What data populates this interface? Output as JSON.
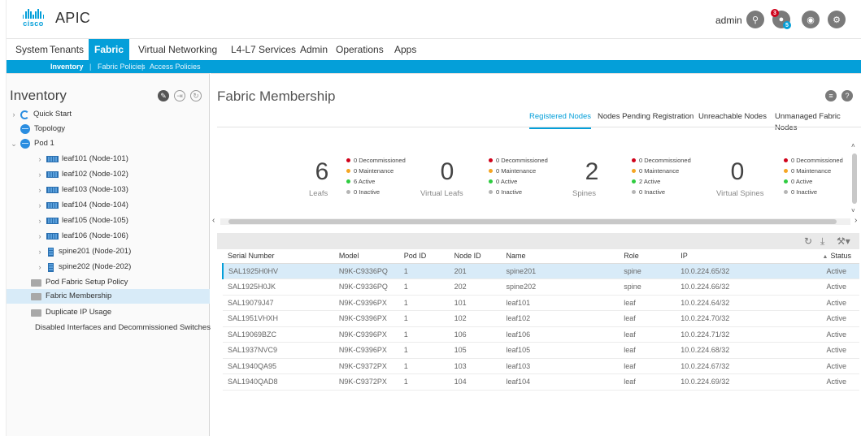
{
  "app": {
    "brand": "cisco",
    "title": "APIC"
  },
  "header": {
    "user": "admin",
    "alerts_count": "3",
    "alerts_sub": "5",
    "icons": [
      "search-icon",
      "bell-icon",
      "user-icon",
      "settings-icon"
    ]
  },
  "nav": {
    "items": [
      "System",
      "Tenants",
      "Fabric",
      "Virtual Networking",
      "L4-L7 Services",
      "Admin",
      "Operations",
      "Apps"
    ],
    "active": "Fabric"
  },
  "subnav": {
    "items": [
      "Inventory",
      "Fabric Policies",
      "Access Policies"
    ],
    "active": "Inventory"
  },
  "sidebar": {
    "title": "Inventory",
    "items": [
      {
        "label": "Quick Start",
        "icon": "quick-start-icon"
      },
      {
        "label": "Topology",
        "icon": "topology-icon"
      },
      {
        "label": "Pod 1",
        "icon": "pod-icon"
      },
      {
        "label": "leaf101 (Node-101)",
        "icon": "leaf-switch-icon"
      },
      {
        "label": "leaf102 (Node-102)",
        "icon": "leaf-switch-icon"
      },
      {
        "label": "leaf103 (Node-103)",
        "icon": "leaf-switch-icon"
      },
      {
        "label": "leaf104 (Node-104)",
        "icon": "leaf-switch-icon"
      },
      {
        "label": "leaf105 (Node-105)",
        "icon": "leaf-switch-icon"
      },
      {
        "label": "leaf106 (Node-106)",
        "icon": "leaf-switch-icon"
      },
      {
        "label": "spine201 (Node-201)",
        "icon": "spine-switch-icon"
      },
      {
        "label": "spine202 (Node-202)",
        "icon": "spine-switch-icon"
      },
      {
        "label": "Pod Fabric Setup Policy",
        "icon": "folder-icon"
      },
      {
        "label": "Fabric Membership",
        "icon": "folder-icon"
      },
      {
        "label": "Duplicate IP Usage",
        "icon": "folder-icon"
      },
      {
        "label": "Disabled Interfaces and Decommissioned Switches",
        "icon": "folder-icon"
      }
    ],
    "selected": "Fabric Membership"
  },
  "main": {
    "title": "Fabric Membership",
    "tabs": [
      "Registered Nodes",
      "Nodes Pending Registration",
      "Unreachable Nodes",
      "Unmanaged Fabric Nodes"
    ],
    "active_tab": "Registered Nodes"
  },
  "summary": [
    {
      "count": "6",
      "label": "Leafs",
      "stats": [
        "0 Decommissioned",
        "0 Maintenance",
        "6 Active",
        "0 Inactive"
      ]
    },
    {
      "count": "0",
      "label": "Virtual Leafs",
      "stats": [
        "0 Decommissioned",
        "0 Maintenance",
        "0 Active",
        "0 Inactive"
      ]
    },
    {
      "count": "2",
      "label": "Spines",
      "stats": [
        "0 Decommissioned",
        "0 Maintenance",
        "2 Active",
        "0 Inactive"
      ]
    },
    {
      "count": "0",
      "label": "Virtual Spines",
      "stats": [
        "0 Decommissioned",
        "0 Maintenance",
        "0 Active",
        "0 Inactive"
      ]
    }
  ],
  "status_colors": {
    "decommissioned": "#d0021b",
    "maintenance": "#f5a623",
    "active": "#2ecc40",
    "inactive": "#b5b5b5"
  },
  "table": {
    "columns": [
      "Serial Number",
      "Model",
      "Pod ID",
      "Node ID",
      "Name",
      "Role",
      "IP",
      "Status"
    ],
    "sort_indicator": "▲",
    "rows": [
      [
        "SAL1925H0HV",
        "N9K-C9336PQ",
        "1",
        "201",
        "spine201",
        "spine",
        "10.0.224.65/32",
        "Active"
      ],
      [
        "SAL1925H0JK",
        "N9K-C9336PQ",
        "1",
        "202",
        "spine202",
        "spine",
        "10.0.224.66/32",
        "Active"
      ],
      [
        "SAL19079J47",
        "N9K-C9396PX",
        "1",
        "101",
        "leaf101",
        "leaf",
        "10.0.224.64/32",
        "Active"
      ],
      [
        "SAL1951VHXH",
        "N9K-C9396PX",
        "1",
        "102",
        "leaf102",
        "leaf",
        "10.0.224.70/32",
        "Active"
      ],
      [
        "SAL19069BZC",
        "N9K-C9396PX",
        "1",
        "106",
        "leaf106",
        "leaf",
        "10.0.224.71/32",
        "Active"
      ],
      [
        "SAL1937NVC9",
        "N9K-C9396PX",
        "1",
        "105",
        "leaf105",
        "leaf",
        "10.0.224.68/32",
        "Active"
      ],
      [
        "SAL1940QA95",
        "N9K-C9372PX",
        "1",
        "103",
        "leaf103",
        "leaf",
        "10.0.224.67/32",
        "Active"
      ],
      [
        "SAL1940QAD8",
        "N9K-C9372PX",
        "1",
        "104",
        "leaf104",
        "leaf",
        "10.0.224.69/32",
        "Active"
      ]
    ],
    "selected_row": 0
  }
}
